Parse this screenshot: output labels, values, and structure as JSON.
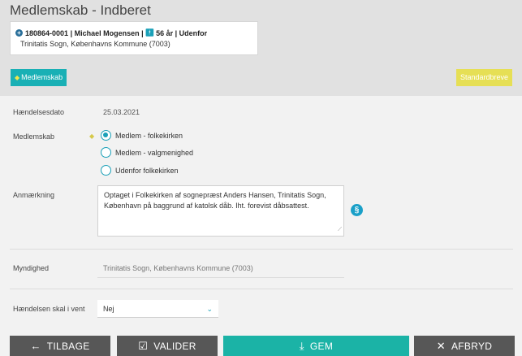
{
  "header": {
    "title": "Medlemskab - Indberet",
    "person": {
      "id": "180864-0001",
      "name": "Michael Mogensen",
      "age": "56 år",
      "status": "Udenfor",
      "parish": "Trinitatis Sogn, Københavns Kommune (7003)"
    },
    "medlemskab_button": "Medlemskab",
    "standardbreve_button": "Standardbreve"
  },
  "form": {
    "date_label": "Hændelsesdato",
    "date_value": "25.03.2021",
    "membership_label": "Medlemskab",
    "options": [
      "Medlem - folkekirken",
      "Medlem - valgmenighed",
      "Udenfor folkekirken"
    ],
    "selected_option": "Medlem - folkekirken",
    "note_label": "Anmærkning",
    "note_text": "Optaget i Folkekirken af sognepræst Anders Hansen, Trinitatis Sogn, København på baggrund af katolsk dåb. Iht. forevist dåbsattest.",
    "authority_label": "Myndighed",
    "authority_value": "Trinitatis Sogn, Københavns Kommune (7003)",
    "pending_label": "Hændelsen skal i vent",
    "pending_value": "Nej"
  },
  "footer": {
    "back": "TILBAGE",
    "validate": "VALIDER",
    "save": "GEM",
    "cancel": "AFBRYD"
  },
  "colors": {
    "accent": "#1aa0b8",
    "save": "#1bb3a6",
    "dark_button": "#575757",
    "standardbreve": "#e6df55"
  }
}
